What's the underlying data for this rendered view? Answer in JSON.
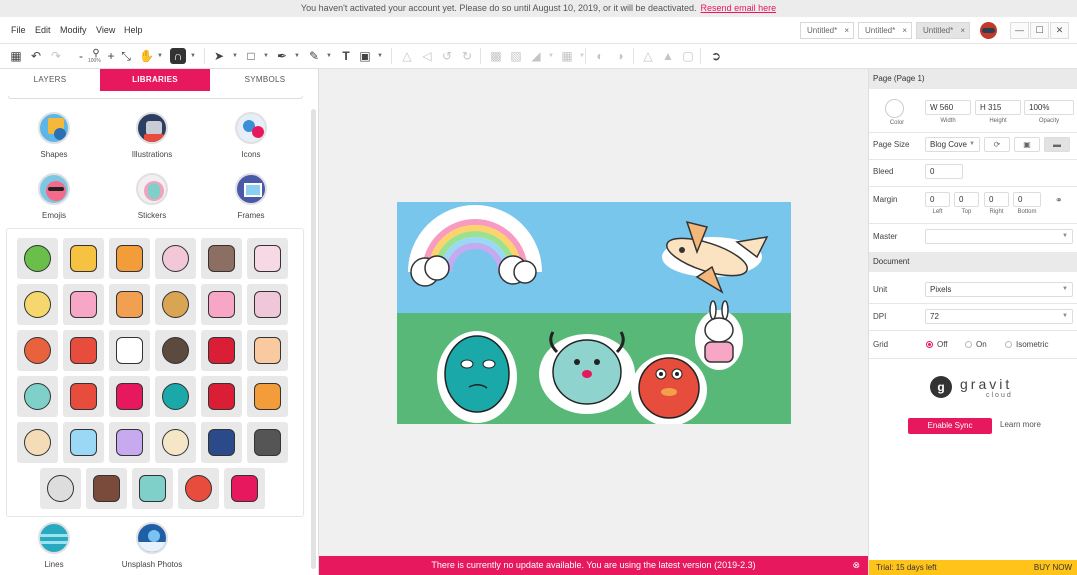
{
  "notice": {
    "text": "You haven't activated your account yet. Please do so until August 10, 2019, or it will be deactivated.",
    "link": "Resend email here"
  },
  "menu": {
    "file": "File",
    "edit": "Edit",
    "modify": "Modify",
    "view": "View",
    "help": "Help"
  },
  "doc_tabs": [
    {
      "label": "Untitled*",
      "close": "×"
    },
    {
      "label": "Untitled*",
      "close": "×"
    },
    {
      "label": "Untitled*",
      "close": "×"
    }
  ],
  "window": {
    "minimize": "—",
    "maximize": "☐",
    "close": "✕"
  },
  "toolbar": {
    "zoom_level": "100%"
  },
  "left_tabs": {
    "layers": "LAYERS",
    "libraries": "LIBRARIES",
    "symbols": "SYMBOLS"
  },
  "categories": {
    "shapes": "Shapes",
    "illustrations": "Illustrations",
    "icons": "Icons",
    "emojis": "Emojis",
    "stickers": "Stickers",
    "frames": "Frames",
    "lines": "Lines",
    "unsplash": "Unsplash Photos"
  },
  "stickers": [
    "alien",
    "banana",
    "lightning",
    "cat-face",
    "camera",
    "unicorn-cat",
    "rainbow-cat",
    "cupcake",
    "fox-glasses",
    "doge",
    "donut",
    "tulip",
    "fox",
    "fries",
    "ghost",
    "headphones",
    "heart",
    "ice-cream",
    "monster-blue",
    "crab-red",
    "monster-pink",
    "monster-teal",
    "lips",
    "pizza",
    "airplane",
    "rainbow",
    "shell",
    "skull",
    "bag-out",
    "star-tattoo",
    "troll-face",
    "umbrella",
    "unicorn",
    "watermelon",
    "whatever-heart"
  ],
  "bottom_bar": {
    "message": "There is currently no update available. You are using the latest version (2019-2.3)",
    "close": "⊗"
  },
  "right_panel": {
    "page_header": "Page (Page 1)",
    "color_label": "Color",
    "width_prefix": "W",
    "width_value": "560",
    "width_label": "Width",
    "height_prefix": "H",
    "height_value": "315",
    "height_label": "Height",
    "opacity_value": "100%",
    "opacity_label": "Opacity",
    "page_size_label": "Page Size",
    "page_size_value": "Blog Cove",
    "bleed_label": "Bleed",
    "bleed_value": "0",
    "margin_label": "Margin",
    "margin_left": "0",
    "margin_top": "0",
    "margin_right": "0",
    "margin_bottom": "0",
    "left_label": "Left",
    "top_label": "Top",
    "right_label": "Right",
    "bottom_label": "Bottom",
    "master_label": "Master",
    "master_value": "",
    "document_header": "Document",
    "unit_label": "Unit",
    "unit_value": "Pixels",
    "dpi_label": "DPI",
    "dpi_value": "72",
    "grid_label": "Grid",
    "grid_off": "Off",
    "grid_on": "On",
    "grid_iso": "Isometric",
    "brand_name": "gravit",
    "brand_sub": "cloud",
    "sync_button": "Enable Sync",
    "learn_more": "Learn more",
    "trial": "Trial: 15 days left",
    "buy_now": "BUY NOW"
  },
  "colors": {
    "accent": "#e8185e",
    "sky": "#78c6ec",
    "grass": "#58b878",
    "trial": "#ffc31a"
  }
}
